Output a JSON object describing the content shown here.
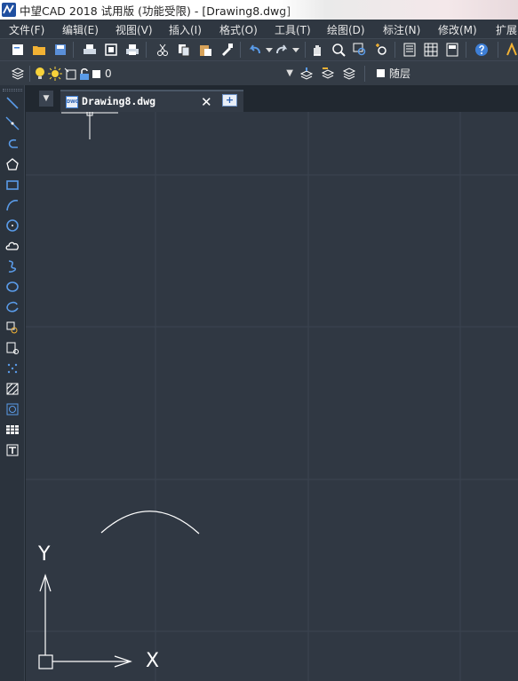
{
  "window": {
    "title": "中望CAD 2018 试用版 (功能受限) - [Drawing8.dwg]"
  },
  "menu": {
    "items": [
      "文件(F)",
      "编辑(E)",
      "视图(V)",
      "插入(I)",
      "格式(O)",
      "工具(T)",
      "绘图(D)",
      "标注(N)",
      "修改(M)",
      "扩展"
    ]
  },
  "layer_toolbar": {
    "current_layer": "0",
    "color_control": "随层"
  },
  "tabs": {
    "document": "Drawing8.dwg",
    "doc_icon_text": "DWG"
  },
  "canvas": {
    "ucs_x_label": "X",
    "ucs_y_label": "Y"
  },
  "icons": {
    "standard_toolbar": [
      "new-icon",
      "open-icon",
      "save-icon",
      "print-icon",
      "preview-icon",
      "plot-icon",
      "cut-icon",
      "copy-icon",
      "paste-icon",
      "match-properties-icon",
      "undo-icon",
      "redo-icon",
      "pan-icon",
      "zoom-realtime-icon",
      "zoom-window-icon",
      "zoom-previous-icon",
      "properties-icon",
      "design-center-icon",
      "tool-palette-icon",
      "help-icon"
    ],
    "draw_toolbar": [
      "line-icon",
      "construction-line-icon",
      "polyline-icon",
      "polygon-icon",
      "rectangle-icon",
      "arc-icon",
      "circle-icon",
      "revision-cloud-icon",
      "spline-icon",
      "ellipse-icon",
      "ellipse-arc-icon",
      "insert-block-icon",
      "make-block-icon",
      "point-icon",
      "hatch-icon",
      "region-icon",
      "table-icon",
      "multiline-text-icon"
    ]
  },
  "colors": {
    "canvas_bg": "#303843",
    "grid_major": "#3e4753",
    "toolbar_bg": "#343c46",
    "menubar_bg": "#2f3741",
    "accent_blue": "#3e7fd6"
  }
}
